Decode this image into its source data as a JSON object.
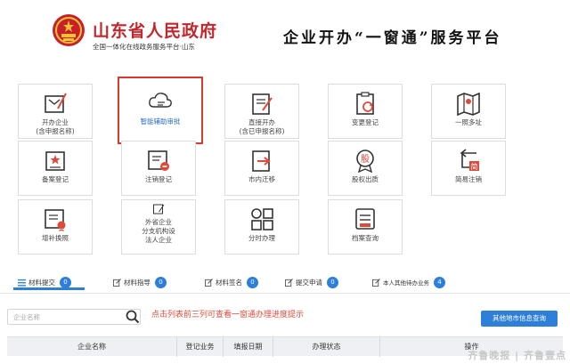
{
  "header": {
    "gov_title": "山东省人民政府",
    "gov_subtitle": "全国一体化在线政务服务平台·山东",
    "platform_title": "企业开办“一窗通”服务平台"
  },
  "colors": {
    "accent": "#2d7fd8",
    "brand_red": "#c1272d",
    "highlight": "#d63a2f",
    "hint": "#e04a3a"
  },
  "tiles": [
    {
      "icon": "open-business-icon",
      "line1": "开办企业",
      "line2": "(含申报名称)"
    },
    {
      "icon": "cloud-review-icon",
      "line1": "智能辅助审批",
      "line2": ""
    },
    {
      "icon": "direct-open-icon",
      "line1": "直接开办",
      "line2": "(含已申报名称)"
    },
    {
      "icon": "change-registration-icon",
      "line1": "变更登记",
      "line2": ""
    },
    {
      "icon": "one-site-multi-address-icon",
      "line1": "一照多址",
      "line2": ""
    },
    {
      "icon": "filing-registration-icon",
      "line1": "备案登记",
      "line2": ""
    },
    {
      "icon": "deregistration-icon",
      "line1": "注销登记",
      "line2": ""
    },
    {
      "icon": "in-city-relocation-icon",
      "line1": "市内迁移",
      "line2": ""
    },
    {
      "icon": "equity-pledge-icon",
      "line1": "股权出质",
      "line2": ""
    },
    {
      "icon": "simple-deregistration-icon",
      "line1": "简易注销",
      "line2": ""
    },
    {
      "icon": "license-reissue-icon",
      "line1": "增补换照",
      "line2": ""
    },
    {
      "icon": "foreign-enterprise-icon",
      "line1": "外省企业",
      "line2": "分支机构设",
      "line3": "法人企业"
    },
    {
      "icon": "time-based-service-icon",
      "line1": "分时办理",
      "line2": ""
    },
    {
      "icon": "archive-query-icon",
      "line1": "档案查询",
      "line2": ""
    }
  ],
  "tabs": [
    {
      "label": "材料提交",
      "count": "0"
    },
    {
      "label": "材料指导",
      "count": "0"
    },
    {
      "label": "材料签名",
      "count": "0"
    },
    {
      "label": "提交申请",
      "count": "0"
    },
    {
      "label": "本人其他待办业务",
      "count": "4"
    }
  ],
  "search": {
    "placeholder": "企业名称",
    "hint": "点击列表前三列可查看一窗通办理进度提示",
    "other_button": "其他地市信息查询"
  },
  "table": {
    "columns": [
      "企业名称",
      "登记业务",
      "填报日期",
      "办理状态",
      "操作"
    ]
  },
  "watermark": "齐鲁晚报 | 齐鲁壹点"
}
